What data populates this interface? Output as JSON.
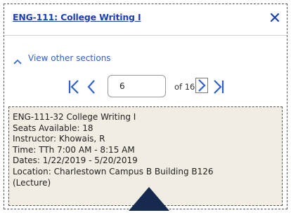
{
  "header": {
    "course_title": "ENG-111: College Writing I",
    "close_icon": "close-icon"
  },
  "sections_toggle": {
    "label": "View other sections",
    "icon": "chevron-up-icon"
  },
  "pager": {
    "current_page": "6",
    "of_total": "of 16",
    "icons": [
      "first-page-icon",
      "prev-page-icon",
      "next-page-icon",
      "last-page-icon"
    ]
  },
  "section_info": {
    "lines": [
      "ENG-111-32 College Writing I",
      "Seats Available: 18",
      "Instructor: Khowais, R",
      "Time: TTh 7:00 AM - 8:15 AM",
      "Dates: 1/22/2019 - 5/20/2019",
      "Location: Charlestown Campus B Building B126",
      "(Lecture)"
    ]
  },
  "colors": {
    "link": "#1a3fb8",
    "accent": "#2f5fcf",
    "info_bg": "#f1ede2",
    "pointer": "#16294f"
  }
}
